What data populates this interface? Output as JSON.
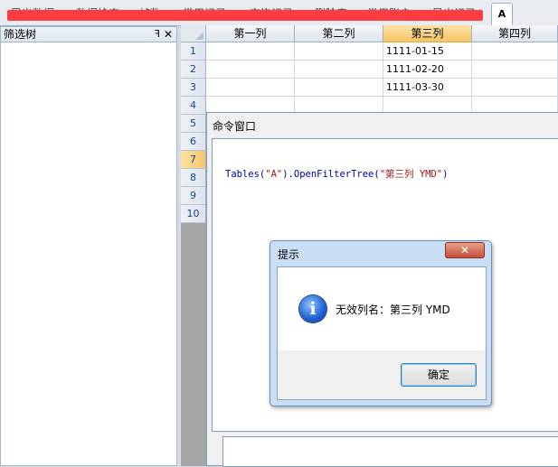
{
  "top_tabs": [
    "导出数据",
    "数据检查",
    "帧数",
    "常用记录",
    "查询记录",
    "删除表",
    "常用账户",
    "导出记录"
  ],
  "active_tab": "A",
  "filter_panel": {
    "title": "筛选树",
    "pin_glyph": "ꟻ",
    "close_glyph": "✕"
  },
  "grid": {
    "columns": [
      "第一列",
      "第二列",
      "第三列",
      "第四列"
    ],
    "active_column": 2,
    "row_numbers": [
      "1",
      "2",
      "3",
      "4",
      "5",
      "6",
      "7",
      "8",
      "9",
      "10"
    ],
    "active_row": 6,
    "rows": [
      [
        "",
        "",
        "1111-01-15",
        ""
      ],
      [
        "",
        "",
        "1111-02-20",
        ""
      ],
      [
        "",
        "",
        "1111-03-30",
        ""
      ],
      [
        "",
        "",
        "",
        ""
      ]
    ]
  },
  "command_window": {
    "title": "命令窗口",
    "code_prefix": "Tables(",
    "code_arg1": "\"A\"",
    "code_mid": ").OpenFilterTree(",
    "code_arg2": "\"第三列 YMD\"",
    "code_suffix": ")"
  },
  "dialog": {
    "title": "提示",
    "close_glyph": "✕",
    "icon": "info-icon",
    "message": "无效列名：第三列 YMD",
    "ok_label": "确定"
  },
  "colors": {
    "redaction": "#ff3c41",
    "active_header": "#f5c566",
    "dialog_frame": "#c9dff6"
  }
}
